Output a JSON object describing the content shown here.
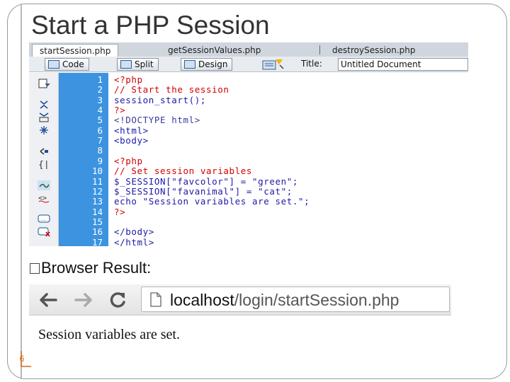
{
  "slide": {
    "title": "Start a PHP Session",
    "page_number": "6",
    "browser_label": "Browser Result:"
  },
  "editor": {
    "tabs": [
      "startSession.php",
      "getSessionValues.php",
      "destroySession.php"
    ],
    "toolbar": {
      "code_label": "Code",
      "split_label": "Split",
      "design_label": "Design",
      "title_label": "Title:",
      "title_value": "Untitled Document"
    },
    "line_numbers": [
      "1",
      "2",
      "3",
      "4",
      "5",
      "6",
      "7",
      "8",
      "9",
      "10",
      "11",
      "12",
      "13",
      "14",
      "15",
      "16",
      "17"
    ],
    "lines": [
      "<?php",
      "// Start the session",
      "session_start();",
      "?>",
      "<!DOCTYPE html>",
      "<html>",
      "<body>",
      "",
      "<?php",
      "// Set session variables",
      "$_SESSION[\"favcolor\"] = \"green\";",
      "$_SESSION[\"favanimal\"] = \"cat\";",
      "echo \"Session variables are set.\";",
      "?>",
      "",
      "</body>",
      "</html>"
    ],
    "line_colors": [
      "#d20000",
      "#d20000",
      "#1a1aa6",
      "#d20000",
      "#3a3aa0",
      "#1a1aa6",
      "#1a1aa6",
      "#000000",
      "#d20000",
      "#d20000",
      "#1a1aa6",
      "#1a1aa6",
      "#1a1aa6",
      "#d20000",
      "#000000",
      "#1a1aa6",
      "#1a1aa6"
    ]
  },
  "browser": {
    "url_host": "localhost",
    "url_path": "/login/startSession.php",
    "result_text": "Session variables are set."
  },
  "colors": {
    "gutter": "#3c93e0",
    "accent_orange": "#d06c1c"
  },
  "icons": {
    "back": "arrow-left-icon",
    "forward": "arrow-right-icon",
    "reload": "reload-icon",
    "page": "page-icon"
  }
}
